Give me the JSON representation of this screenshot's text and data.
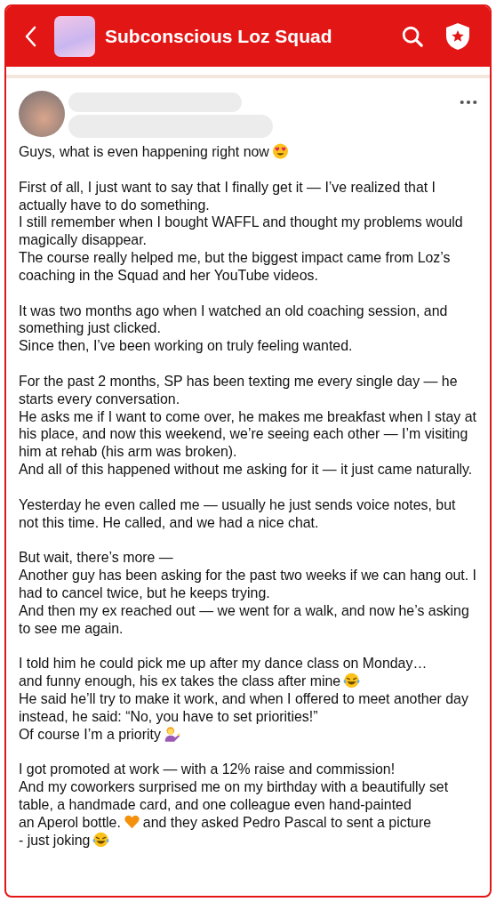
{
  "header": {
    "title": "Subconscious Loz Squad"
  },
  "post": {
    "paragraphs": [
      [
        [
          {
            "text": "Guys, what is even happening right now"
          },
          {
            "kind": "adoring"
          }
        ]
      ],
      [
        [
          {
            "text": "First of all, I just want to say that I finally get it — I’ve realized that I actually have to do something."
          }
        ],
        [
          {
            "text": "I still remember when I bought WAFFL and thought my problems would magically disappear."
          }
        ],
        [
          {
            "text": "The course really helped me, but the biggest impact came from Loz’s coaching in the Squad and her YouTube videos."
          }
        ]
      ],
      [
        [
          {
            "text": "It was two months ago when I watched an old coaching session, and something just clicked."
          }
        ],
        [
          {
            "text": "Since then, I’ve been working on truly feeling wanted."
          }
        ]
      ],
      [
        [
          {
            "text": "For the past 2 months, SP has been texting me every single day — he starts every conversation."
          }
        ],
        [
          {
            "text": "He asks me if I want to come over, he makes me breakfast when I stay at his place, and now this weekend, we’re seeing each other — I’m visiting him at rehab (his arm was broken)."
          }
        ],
        [
          {
            "text": "And all of this happened without me asking for it — it just came naturally."
          }
        ]
      ],
      [
        [
          {
            "text": "Yesterday he even called me — usually he just sends voice notes, but not this time. He called, and we had a nice chat."
          }
        ]
      ],
      [
        [
          {
            "text": "But wait, there’s more —"
          }
        ],
        [
          {
            "text": "Another guy has been asking for the past two weeks if we can hang out. I had to cancel twice, but he keeps trying."
          }
        ],
        [
          {
            "text": "And then my ex reached out — we went for a walk, and now he’s asking to see me again."
          }
        ]
      ],
      [
        [
          {
            "text": "I told him he could pick me up after my dance class on Monday…"
          }
        ],
        [
          {
            "text": "and funny enough, his ex takes the class after mine"
          },
          {
            "kind": "laughing"
          }
        ],
        [
          {
            "text": "He said he’ll try to make it work, and when I offered to meet another day instead, he said: “No, you have to set priorities!”"
          }
        ],
        [
          {
            "text": "Of course I’m a priority"
          },
          {
            "kind": "gesture"
          }
        ]
      ],
      [
        [
          {
            "text": "I got promoted at work — with a 12% raise and commission!"
          }
        ],
        [
          {
            "text": "And my coworkers surprised me on my birthday with a beautifully set table, a handmade card, and one colleague even hand-painted"
          }
        ],
        [
          {
            "text": "an Aperol bottle."
          },
          {
            "kind": "heart"
          },
          {
            "text": "and they asked Pedro Pascal to sent a picture"
          }
        ],
        [
          {
            "text": "- just joking"
          },
          {
            "kind": "laughing"
          }
        ]
      ]
    ]
  }
}
